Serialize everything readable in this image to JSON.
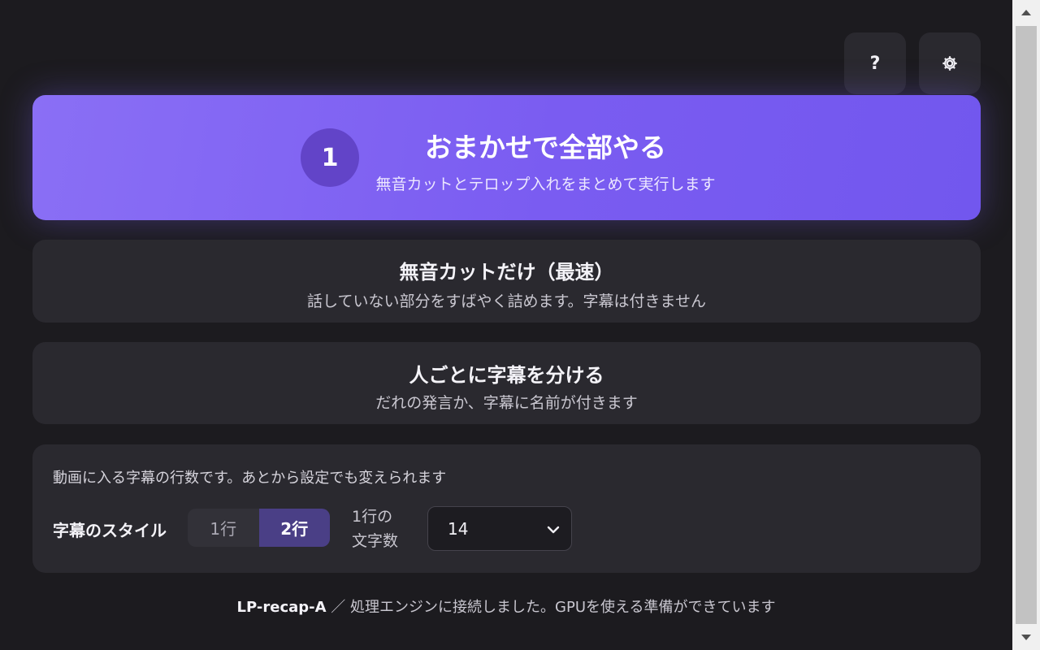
{
  "toolbar": {
    "help_label": "?",
    "settings_icon": "gear-icon"
  },
  "primary_action": {
    "step": "1",
    "title": "おまかせで全部やる",
    "subtitle": "無音カットとテロップ入れをまとめて実行します"
  },
  "cut_only": {
    "title": "無音カットだけ（最速）",
    "subtitle": "話していない部分をすばやく詰めます。字幕は付きません"
  },
  "per_speaker": {
    "title": "人ごとに字幕を分ける",
    "subtitle": "だれの発言か、字幕に名前が付きます"
  },
  "style_panel": {
    "note": "動画に入る字幕の行数です。あとから設定でも変えられます",
    "label": "字幕のスタイル",
    "segments": [
      "1行",
      "2行"
    ],
    "selected_segment": "2行",
    "chars_label_line1": "1行の",
    "chars_label_line2": "文字数",
    "chars_value": "14"
  },
  "status": {
    "project": "LP-recap-A",
    "separator": " ／ ",
    "message": "処理エンジンに接続しました。GPUを使える準備ができています"
  },
  "colors": {
    "accent": "#7a5cf1",
    "background": "#1c1b1f",
    "card": "#2a292f"
  }
}
